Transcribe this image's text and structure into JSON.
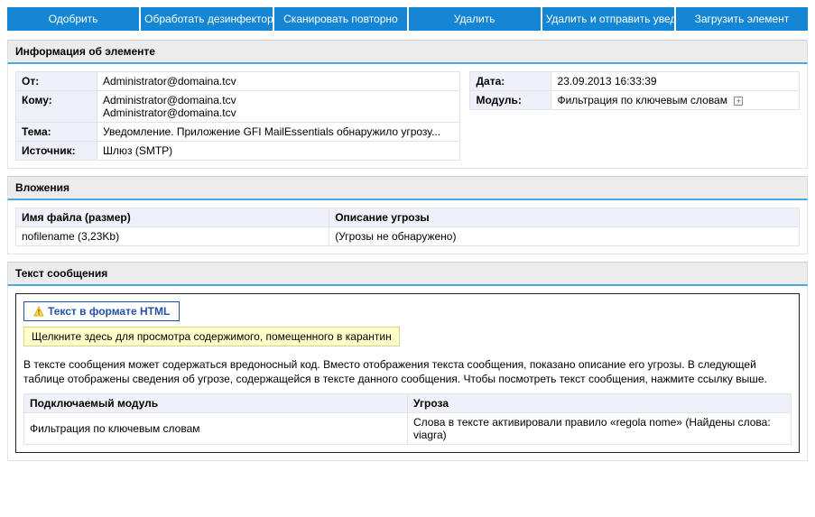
{
  "toolbar": {
    "approve": "Одобрить",
    "disinfect": "Обработать дезинфектором",
    "rescan": "Сканировать повторно",
    "delete": "Удалить",
    "delete_notify": "Удалить и отправить уведомление",
    "download": "Загрузить элемент"
  },
  "info": {
    "heading": "Информация об элементе",
    "left": {
      "from_label": "От:",
      "from_value": "Administrator@domaina.tcv",
      "to_label": "Кому:",
      "to_value": "Administrator@domaina.tcv\nAdministrator@domaina.tcv",
      "subject_label": "Тема:",
      "subject_value": "Уведомление. Приложение GFI MailEssentials обнаружило угрозу...",
      "source_label": "Источник:",
      "source_value": "Шлюз (SMTP)"
    },
    "right": {
      "date_label": "Дата:",
      "date_value": "23.09.2013 16:33:39",
      "module_label": "Модуль:",
      "module_value": "Фильтрация по ключевым словам"
    }
  },
  "attachments": {
    "heading": "Вложения",
    "col_file": "Имя файла (размер)",
    "col_threat": "Описание угрозы",
    "rows": [
      {
        "file": "nofilename (3,23Kb)",
        "threat": "(Угрозы не обнаружено)"
      }
    ]
  },
  "message": {
    "heading": "Текст сообщения",
    "tab_label": "Текст в формате HTML",
    "warn_link": "Щелкните здесь для просмотра содержимого, помещенного в карантин",
    "description": "В тексте сообщения может содержаться вредоносный код. Вместо отображения текста сообщения, показано описание его угрозы. В следующей таблице отображены сведения об угрозе, содержащейся в тексте данного сообщения. Чтобы посмотреть текст сообщения, нажмите ссылку выше.",
    "col_plugin": "Подключаемый модуль",
    "col_threat": "Угроза",
    "rows": [
      {
        "plugin": "Фильтрация по ключевым словам",
        "threat": "Слова в тексте активировали правило «regola nome» (Найдены слова: viagra)"
      }
    ]
  }
}
